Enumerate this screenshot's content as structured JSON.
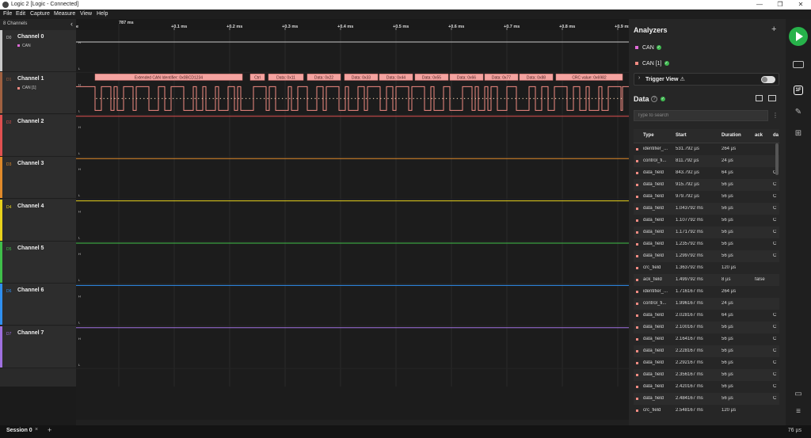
{
  "window": {
    "title": "Logic 2 [Logic - Connected]",
    "minimize": "—",
    "maximize": "❐",
    "close": "✕"
  },
  "menu": [
    "File",
    "Edit",
    "Capture",
    "Measure",
    "View",
    "Help"
  ],
  "channels_header": {
    "count": "8 Channels",
    "collapse": "‹"
  },
  "channels": [
    {
      "id": "D0",
      "name": "Channel 0",
      "analyzer": "CAN",
      "color": "#c8c8c8",
      "an_color": "#e06bd8"
    },
    {
      "id": "D1",
      "name": "Channel 1",
      "analyzer": "CAN [1]",
      "color": "#a06040",
      "an_color": "#f28b82"
    },
    {
      "id": "D2",
      "name": "Channel 2",
      "analyzer": "",
      "color": "#e05050",
      "an_color": ""
    },
    {
      "id": "D3",
      "name": "Channel 3",
      "analyzer": "",
      "color": "#e08a2a",
      "an_color": ""
    },
    {
      "id": "D4",
      "name": "Channel 4",
      "analyzer": "",
      "color": "#e8d21c",
      "an_color": ""
    },
    {
      "id": "D5",
      "name": "Channel 5",
      "analyzer": "",
      "color": "#3fbf4a",
      "an_color": ""
    },
    {
      "id": "D6",
      "name": "Channel 6",
      "analyzer": "",
      "color": "#2f8ff0",
      "an_color": ""
    },
    {
      "id": "D7",
      "name": "Channel 7",
      "analyzer": "",
      "color": "#a070e0",
      "an_color": ""
    }
  ],
  "timeline": {
    "start_label": "787 ms",
    "marker_e": "e",
    "ticks": [
      "+0.1 ms",
      "+0.2 ms",
      "+0.3 ms",
      "+0.4 ms",
      "+0.5 ms",
      "+0.6 ms",
      "+0.7 ms",
      "+0.8 ms",
      "+0.9 ms"
    ]
  },
  "decoded_frames": [
    "Extended CAN Identifier: 0x0BCD1234",
    "Ctrl",
    "Data: 0x11",
    "Data: 0x22",
    "Data: 0x33",
    "Data: 0x44",
    "Data: 0x55",
    "Data: 0x66",
    "Data: 0x77",
    "Data: 0x88",
    "CRC value: 0x6982"
  ],
  "hl": {
    "high": "H",
    "low": "L"
  },
  "analyzers": {
    "title": "Analyzers",
    "add": "+",
    "items": [
      {
        "name": "CAN",
        "color": "#e06bd8"
      },
      {
        "name": "CAN [1]",
        "color": "#f28b82"
      }
    ],
    "check": "✓",
    "trigger_view": "Trigger View ⚠",
    "trigger_chevron": "›"
  },
  "data_section": {
    "title": "Data",
    "help": "?",
    "search_placeholder": "Type to search",
    "more": "⋮",
    "columns": [
      "Type",
      "Start",
      "Duration",
      "ack",
      "da"
    ],
    "rows": [
      [
        "identifier_...",
        "531.792 µs",
        "264 µs",
        "",
        ""
      ],
      [
        "control_fi...",
        "811.792 µs",
        "24 µs",
        "",
        ""
      ],
      [
        "data_field",
        "843.792 µs",
        "64 µs",
        "",
        "C"
      ],
      [
        "data_field",
        "915.792 µs",
        "56 µs",
        "",
        "C"
      ],
      [
        "data_field",
        "979.792 µs",
        "56 µs",
        "",
        "C"
      ],
      [
        "data_field",
        "1.043792 ms",
        "56 µs",
        "",
        "C"
      ],
      [
        "data_field",
        "1.107792 ms",
        "56 µs",
        "",
        "C"
      ],
      [
        "data_field",
        "1.171792 ms",
        "56 µs",
        "",
        "C"
      ],
      [
        "data_field",
        "1.235792 ms",
        "56 µs",
        "",
        "C"
      ],
      [
        "data_field",
        "1.299792 ms",
        "56 µs",
        "",
        "C"
      ],
      [
        "crc_field",
        "1.363792 ms",
        "120 µs",
        "",
        ""
      ],
      [
        "ack_field",
        "1.499792 ms",
        "8 µs",
        "false",
        ""
      ],
      [
        "identifier_...",
        "1.716167 ms",
        "264 µs",
        "",
        ""
      ],
      [
        "control_fi...",
        "1.996167 ms",
        "24 µs",
        "",
        ""
      ],
      [
        "data_field",
        "2.028167 ms",
        "64 µs",
        "",
        "C"
      ],
      [
        "data_field",
        "2.100167 ms",
        "56 µs",
        "",
        "C"
      ],
      [
        "data_field",
        "2.164167 ms",
        "56 µs",
        "",
        "C"
      ],
      [
        "data_field",
        "2.228167 ms",
        "56 µs",
        "",
        "C"
      ],
      [
        "data_field",
        "2.292167 ms",
        "56 µs",
        "",
        "C"
      ],
      [
        "data_field",
        "2.356167 ms",
        "56 µs",
        "",
        "C"
      ],
      [
        "data_field",
        "2.420167 ms",
        "56 µs",
        "",
        "C"
      ],
      [
        "data_field",
        "2.484167 ms",
        "56 µs",
        "",
        "C"
      ],
      [
        "crc_field",
        "2.548167 ms",
        "120 µs",
        "",
        ""
      ]
    ]
  },
  "right_tools": {
    "analyzers": "1F",
    "extensions": "⊞",
    "chat": "▭",
    "menu": "≡",
    "pencil": "✎",
    "screen": "▭"
  },
  "bottom": {
    "session": "Session 0",
    "close": "×",
    "add": "+",
    "zoom": "76 µs"
  }
}
